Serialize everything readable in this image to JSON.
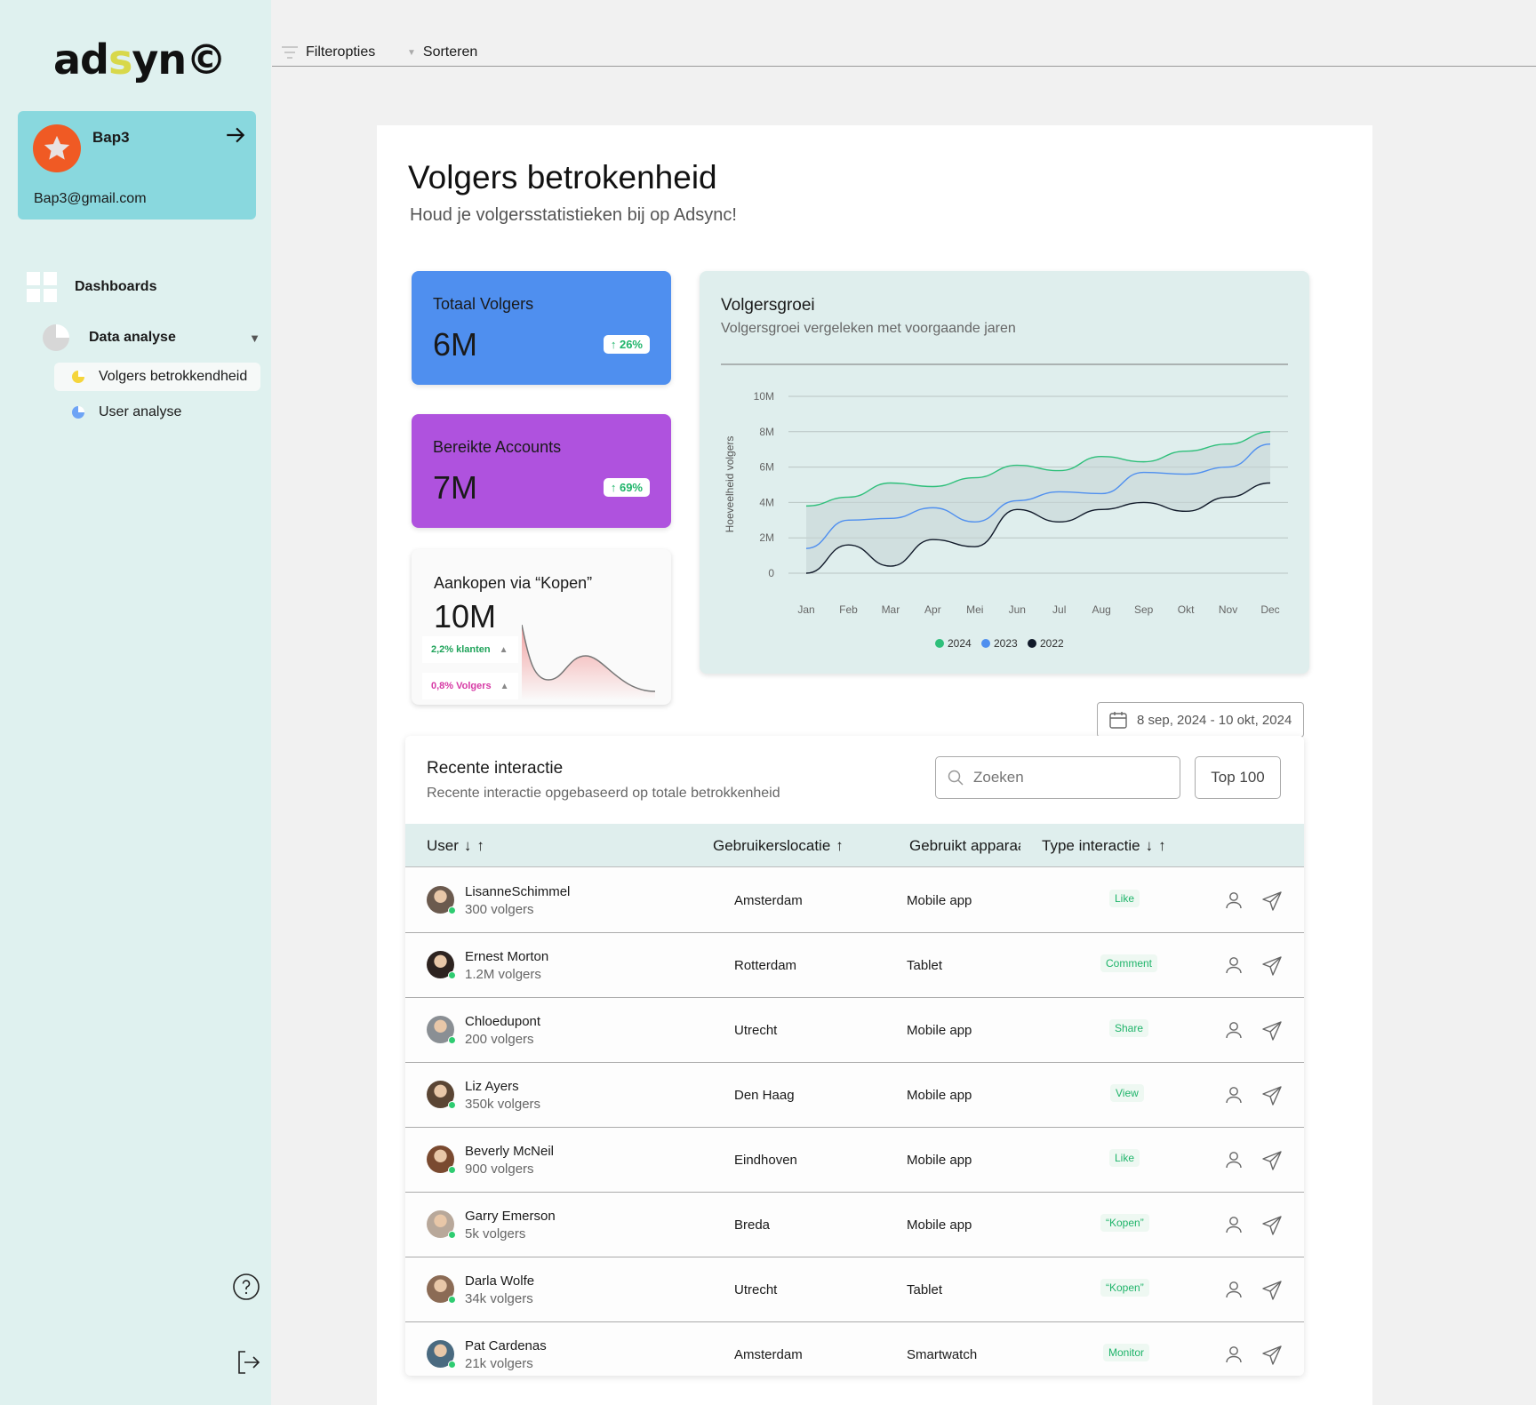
{
  "sidebar": {
    "logo_pre": "ad",
    "logo_hl": "s",
    "logo_post": "yn©",
    "profile": {
      "name": "Bap3",
      "email": "Bap3@gmail.com"
    },
    "nav": {
      "dashboards": "Dashboards",
      "data_analysis": "Data analyse",
      "sub_items": [
        "Volgers betrokkendheid",
        "User analyse"
      ]
    }
  },
  "topbar": {
    "filter": "Filteropties",
    "sort": "Sorteren"
  },
  "page": {
    "title": "Volgers betrokenheid",
    "subtitle": "Houd je volgersstatistieken bij op Adsync!"
  },
  "stats": [
    {
      "label": "Totaal Volgers",
      "value": "6M",
      "change": "26%"
    },
    {
      "label": "Bereikte Accounts",
      "value": "7M",
      "change": "69%"
    }
  ],
  "purchases": {
    "label": "Aankopen via “Kopen”",
    "value": "10M",
    "tag1": "2,2% klanten",
    "tag2": "0,8% Volgers",
    "tag1_color": "#1fa35a",
    "tag2_color": "#d63aa5"
  },
  "chart_data": {
    "type": "line",
    "title": "Volgersgroei",
    "subtitle": "Volgersgroei vergeleken met voorgaande jaren",
    "ylabel": "Hoeveelheid volgers",
    "xlabel": "",
    "ylim": [
      0,
      10
    ],
    "yticks": [
      "0",
      "2M",
      "4M",
      "6M",
      "8M",
      "10M"
    ],
    "x": [
      "Jan",
      "Feb",
      "Mar",
      "Apr",
      "Mei",
      "Jun",
      "Jul",
      "Aug",
      "Sep",
      "Okt",
      "Nov",
      "Dec"
    ],
    "series": [
      {
        "name": "2024",
        "color": "#2ebf7a",
        "values": [
          3.8,
          4.3,
          5.1,
          4.9,
          5.4,
          6.1,
          5.8,
          6.6,
          6.3,
          6.9,
          7.3,
          8.0
        ]
      },
      {
        "name": "2023",
        "color": "#4f8fef",
        "values": [
          1.4,
          3.0,
          3.1,
          3.7,
          2.9,
          4.1,
          4.6,
          4.5,
          5.7,
          5.6,
          6.0,
          7.3
        ]
      },
      {
        "name": "2022",
        "color": "#111a2a",
        "values": [
          0.0,
          1.6,
          0.4,
          1.9,
          1.5,
          3.6,
          2.9,
          3.6,
          4.0,
          3.5,
          4.3,
          5.1
        ]
      }
    ],
    "grid": true,
    "legend": "bottom"
  },
  "date_range": "8 sep, 2024 - 10 okt, 2024",
  "table": {
    "title": "Recente interactie",
    "subtitle": "Recente interactie opgebaseerd op totale betrokkenheid",
    "search_placeholder": "Zoeken",
    "top_button": "Top 100",
    "headers": {
      "user": "User",
      "location": "Gebruikerslocatie",
      "device": "Gebruikt apparaat",
      "type": "Type interactie"
    },
    "rows": [
      {
        "name": "LisanneSchimmel",
        "followers": "300 volgers",
        "location": "Amsterdam",
        "device": "Mobile app",
        "type": "Like",
        "avatar_color": "#6b5a4e"
      },
      {
        "name": "Ernest Morton",
        "followers": "1.2M volgers",
        "location": "Rotterdam",
        "device": "Tablet",
        "type": "Comment",
        "avatar_color": "#2d2320"
      },
      {
        "name": "Chloedupont",
        "followers": "200 volgers",
        "location": "Utrecht",
        "device": "Mobile app",
        "type": "Share",
        "avatar_color": "#8a8f94"
      },
      {
        "name": "Liz Ayers",
        "followers": "350k volgers",
        "location": "Den Haag",
        "device": "Mobile app",
        "type": "View",
        "avatar_color": "#5a4534"
      },
      {
        "name": "Beverly McNeil",
        "followers": "900 volgers",
        "location": "Eindhoven",
        "device": "Mobile app",
        "type": "Like",
        "avatar_color": "#7a4a30"
      },
      {
        "name": "Garry Emerson",
        "followers": "5k volgers",
        "location": "Breda",
        "device": "Mobile app",
        "type": "“Kopen”",
        "avatar_color": "#b8a89a"
      },
      {
        "name": "Darla Wolfe",
        "followers": "34k volgers",
        "location": "Utrecht",
        "device": "Tablet",
        "type": "“Kopen”",
        "avatar_color": "#8b6b55"
      },
      {
        "name": "Pat Cardenas",
        "followers": "21k volgers",
        "location": "Amsterdam",
        "device": "Smartwatch",
        "type": "Monitor",
        "avatar_color": "#4a6a80"
      }
    ]
  }
}
